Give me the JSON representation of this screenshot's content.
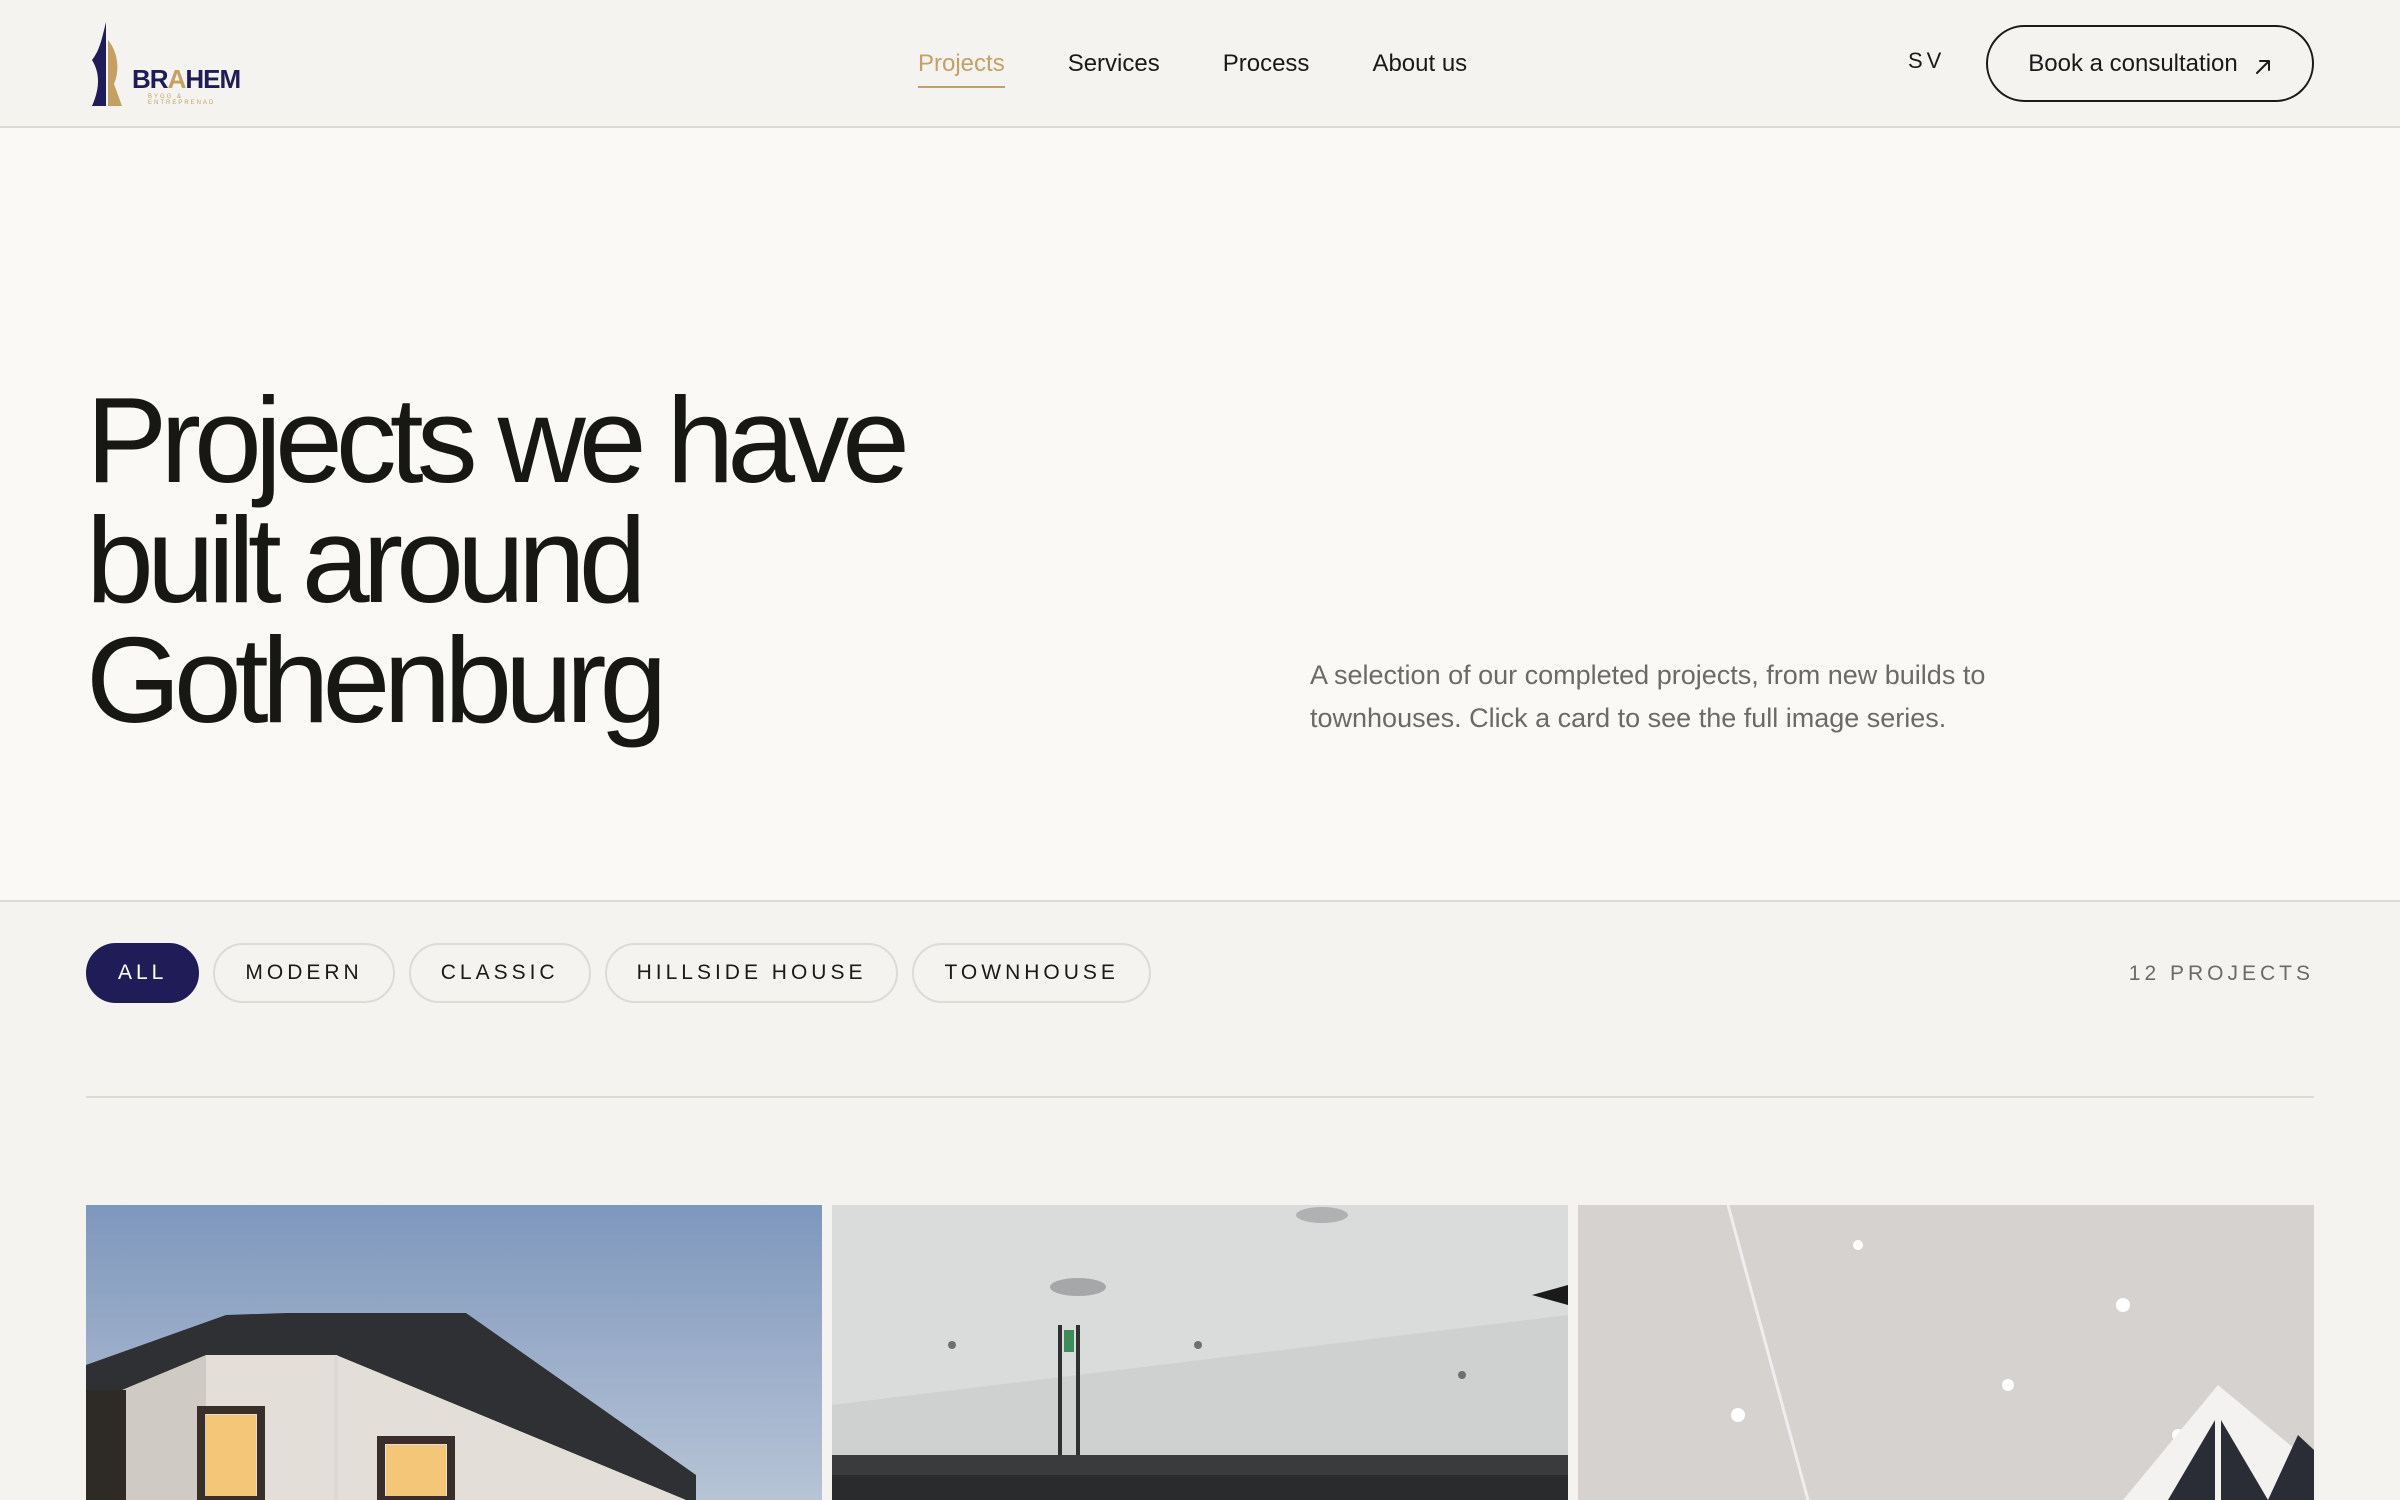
{
  "header": {
    "logo": {
      "name": "logo-icon",
      "text_main": "BR",
      "text_accent": "A",
      "text_end": "HEM",
      "tagline": "BYGG & ENTREPRENAD"
    },
    "nav": [
      {
        "label": "Projects",
        "active": true
      },
      {
        "label": "Services",
        "active": false
      },
      {
        "label": "Process",
        "active": false
      },
      {
        "label": "About us",
        "active": false
      }
    ],
    "language": "SV",
    "cta_label": "Book a consultation",
    "cta_icon": "arrow-up-right-icon"
  },
  "hero": {
    "title": "Projects we have built around Gothenburg",
    "description": "A selection of our completed projects, from new builds to townhouses. Click a card to see the full image series."
  },
  "filters": {
    "chips": [
      {
        "label": "ALL",
        "active": true
      },
      {
        "label": "MODERN",
        "active": false
      },
      {
        "label": "CLASSIC",
        "active": false
      },
      {
        "label": "HILLSIDE HOUSE",
        "active": false
      },
      {
        "label": "TOWNHOUSE",
        "active": false
      }
    ],
    "count_label": "12 PROJECTS"
  },
  "projects": [
    {
      "image": "house-exterior-photo"
    },
    {
      "image": "kitchen-interior-photo"
    },
    {
      "image": "vaulted-living-room-photo"
    }
  ],
  "colors": {
    "accent_gold": "#c4a064",
    "brand_navy": "#1f1c57",
    "background": "#f4f3ef",
    "hero_background": "#faf9f6",
    "text_dark": "#1a1a18",
    "text_muted": "#6b6a66"
  }
}
